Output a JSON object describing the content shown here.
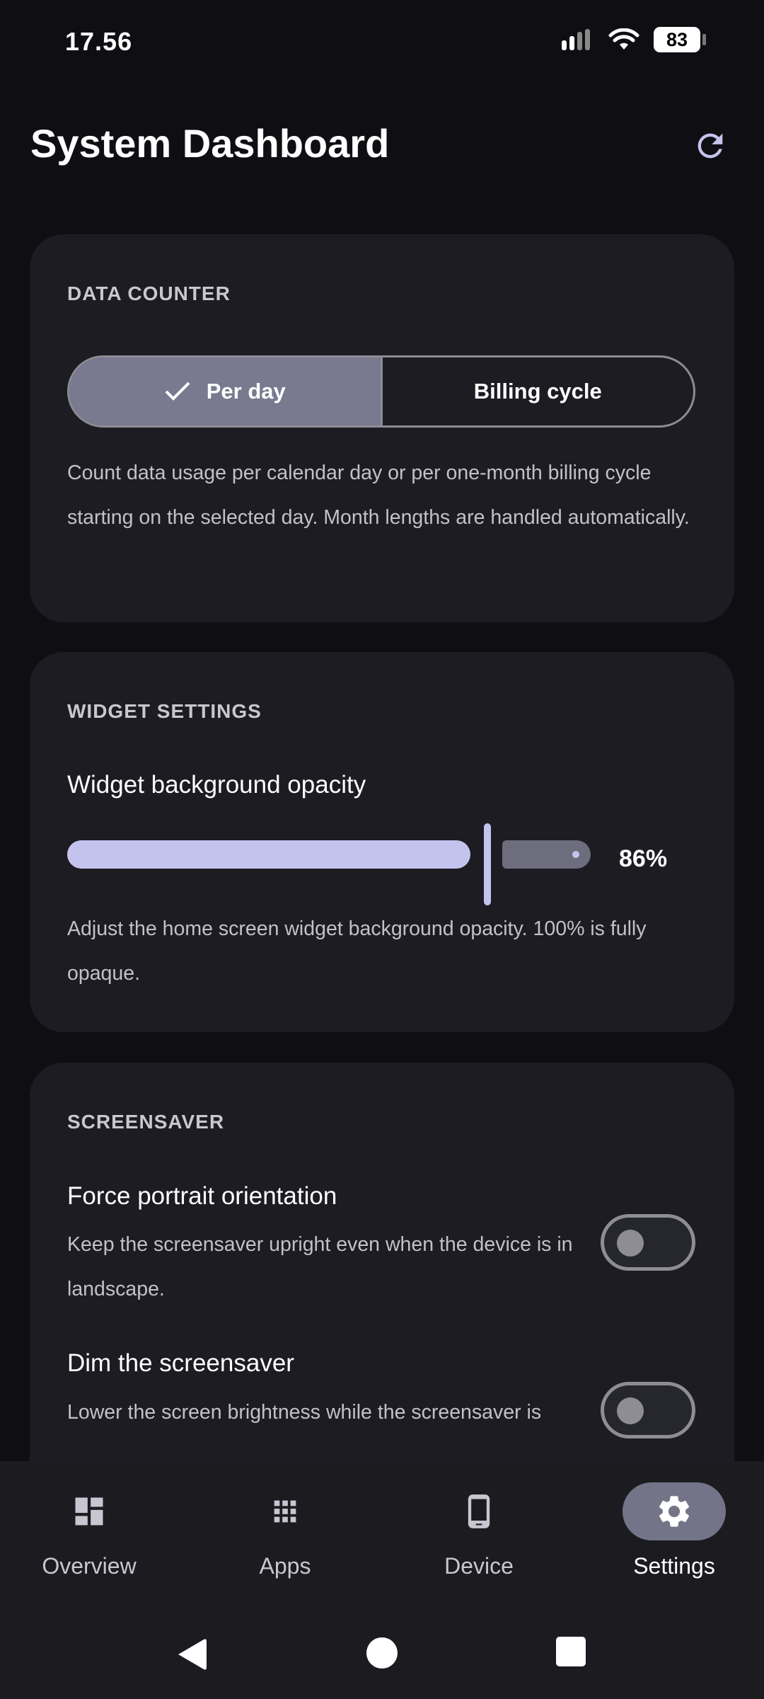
{
  "status_bar": {
    "time": "17.56",
    "battery": "83"
  },
  "header": {
    "title": "System Dashboard"
  },
  "data_counter": {
    "section_title": "DATA COUNTER",
    "options": [
      "Per day",
      "Billing cycle"
    ],
    "selected": "Per day",
    "description": "Count data usage per calendar day or per one-month billing cycle starting on the selected day. Month lengths are handled automatically."
  },
  "widget_settings": {
    "section_title": "WIDGET SETTINGS",
    "opacity_label": "Widget background opacity",
    "opacity_value": 0.86,
    "opacity_display": "86%",
    "description": "Adjust the home screen widget background opacity. 100% is fully opaque."
  },
  "screensaver": {
    "section_title": "SCREENSAVER",
    "items": [
      {
        "title": "Force portrait orientation",
        "description": "Keep the screensaver upright even when the device is in landscape.",
        "enabled": false
      },
      {
        "title": "Dim the screensaver",
        "description": "Lower the screen brightness while the screensaver is",
        "enabled": false
      }
    ]
  },
  "bottom_nav": {
    "items": [
      {
        "label": "Overview",
        "icon": "dashboard-icon"
      },
      {
        "label": "Apps",
        "icon": "apps-grid-icon"
      },
      {
        "label": "Device",
        "icon": "phone-icon"
      },
      {
        "label": "Settings",
        "icon": "gear-icon"
      }
    ],
    "active": "Settings"
  },
  "colors": {
    "accent": "#c4c3ee",
    "card": "#1c1c22",
    "background": "#0f0f13"
  }
}
